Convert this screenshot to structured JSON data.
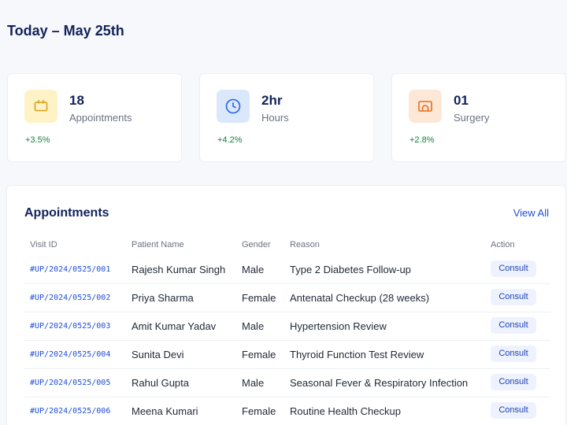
{
  "header": {
    "title": "Today – May 25th"
  },
  "stats": [
    {
      "value": "18",
      "label": "Appointments",
      "change": "+3.5%",
      "icon": "calendar-icon",
      "icon_bg": "#fef3c7",
      "icon_color": "#d9a11a"
    },
    {
      "value": "2hr",
      "label": "Hours",
      "change": "+4.2%",
      "icon": "clock-icon",
      "icon_bg": "#dbe7fb",
      "icon_color": "#2563eb"
    },
    {
      "value": "01",
      "label": "Surgery",
      "change": "+2.8%",
      "icon": "surgery-icon",
      "icon_bg": "#fde8d7",
      "icon_color": "#ea6a1a"
    }
  ],
  "appointments": {
    "title": "Appointments",
    "view_all": "View All",
    "columns": [
      "Visit ID",
      "Patient Name",
      "Gender",
      "Reason",
      "Action"
    ],
    "rows": [
      {
        "visit_id": "#UP/2024/0525/001",
        "patient": "Rajesh Kumar Singh",
        "gender": "Male",
        "reason": "Type 2 Diabetes Follow-up",
        "action": "Consult"
      },
      {
        "visit_id": "#UP/2024/0525/002",
        "patient": "Priya Sharma",
        "gender": "Female",
        "reason": "Antenatal Checkup (28 weeks)",
        "action": "Consult"
      },
      {
        "visit_id": "#UP/2024/0525/003",
        "patient": "Amit Kumar Yadav",
        "gender": "Male",
        "reason": "Hypertension Review",
        "action": "Consult"
      },
      {
        "visit_id": "#UP/2024/0525/004",
        "patient": "Sunita Devi",
        "gender": "Female",
        "reason": "Thyroid Function Test Review",
        "action": "Consult"
      },
      {
        "visit_id": "#UP/2024/0525/005",
        "patient": "Rahul Gupta",
        "gender": "Male",
        "reason": "Seasonal Fever & Respiratory Infection",
        "action": "Consult"
      },
      {
        "visit_id": "#UP/2024/0525/006",
        "patient": "Meena Kumari",
        "gender": "Female",
        "reason": "Routine Health Checkup",
        "action": "Consult"
      }
    ]
  }
}
